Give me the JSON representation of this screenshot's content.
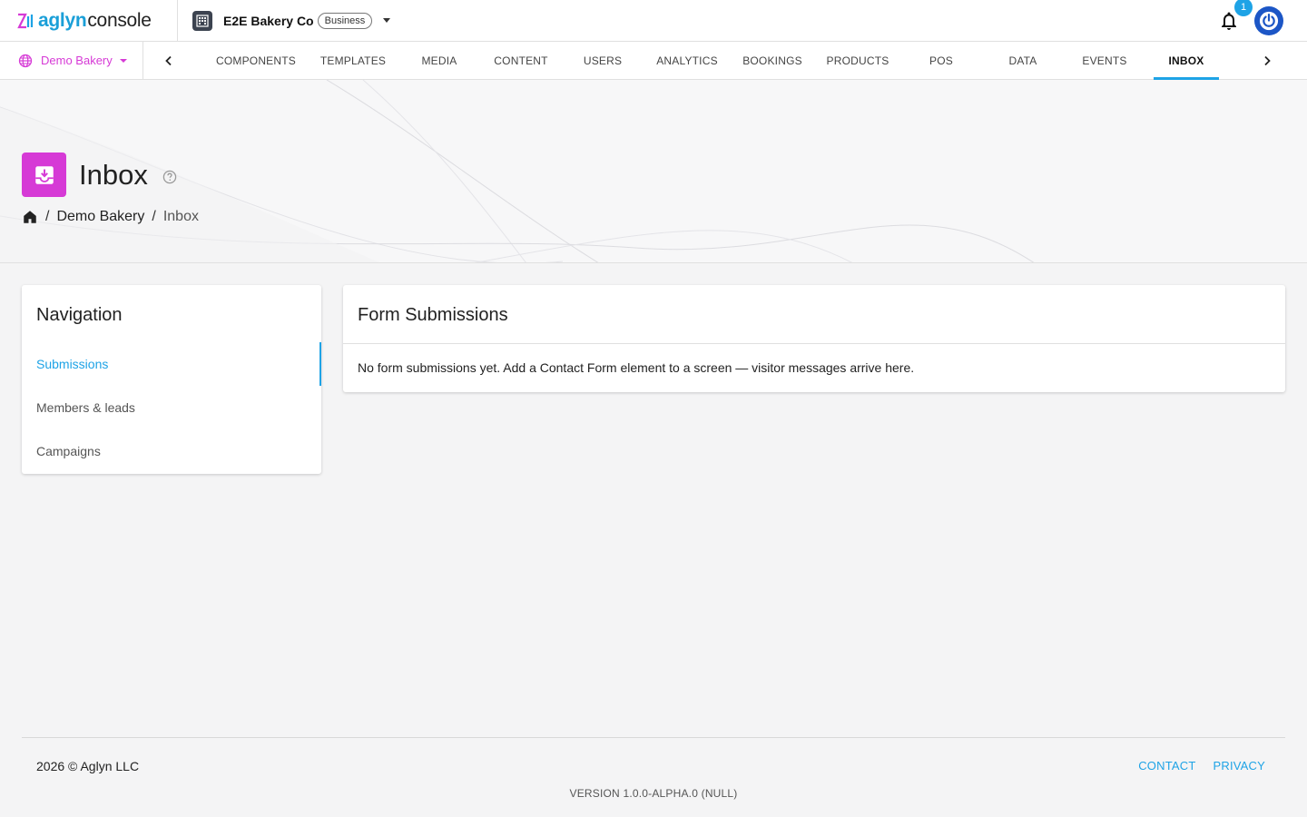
{
  "app": {
    "logo_primary": "aglyn",
    "logo_secondary": "console"
  },
  "company": {
    "name": "E2E Bakery Co",
    "plan": "Business"
  },
  "notifications": {
    "count": "1"
  },
  "site_selector": {
    "label": "Demo Bakery"
  },
  "tabs": [
    {
      "label": "COMPONENTS"
    },
    {
      "label": "TEMPLATES"
    },
    {
      "label": "MEDIA"
    },
    {
      "label": "CONTENT"
    },
    {
      "label": "USERS"
    },
    {
      "label": "ANALYTICS"
    },
    {
      "label": "BOOKINGS"
    },
    {
      "label": "PRODUCTS"
    },
    {
      "label": "POS"
    },
    {
      "label": "DATA"
    },
    {
      "label": "EVENTS"
    },
    {
      "label": "INBOX",
      "active": true
    }
  ],
  "page": {
    "title": "Inbox"
  },
  "breadcrumb": {
    "sep": "/",
    "site": "Demo Bakery",
    "current": "Inbox"
  },
  "navigation_card": {
    "title": "Navigation",
    "items": [
      {
        "label": "Submissions",
        "active": true
      },
      {
        "label": "Members & leads"
      },
      {
        "label": "Campaigns"
      }
    ]
  },
  "forms_card": {
    "title": "Form Submissions",
    "empty_message": "No form submissions yet. Add a Contact Form element to a screen — visitor messages arrive here."
  },
  "footer": {
    "copyright": "2026 © Aglyn LLC",
    "contact": "CONTACT",
    "privacy": "PRIVACY",
    "version": "VERSION 1.0.0-ALPHA.0 (NULL)"
  },
  "colors": {
    "accent_blue": "#1ea3e6",
    "accent_magenta": "#d63ad6",
    "power_button": "#1c56c6"
  }
}
